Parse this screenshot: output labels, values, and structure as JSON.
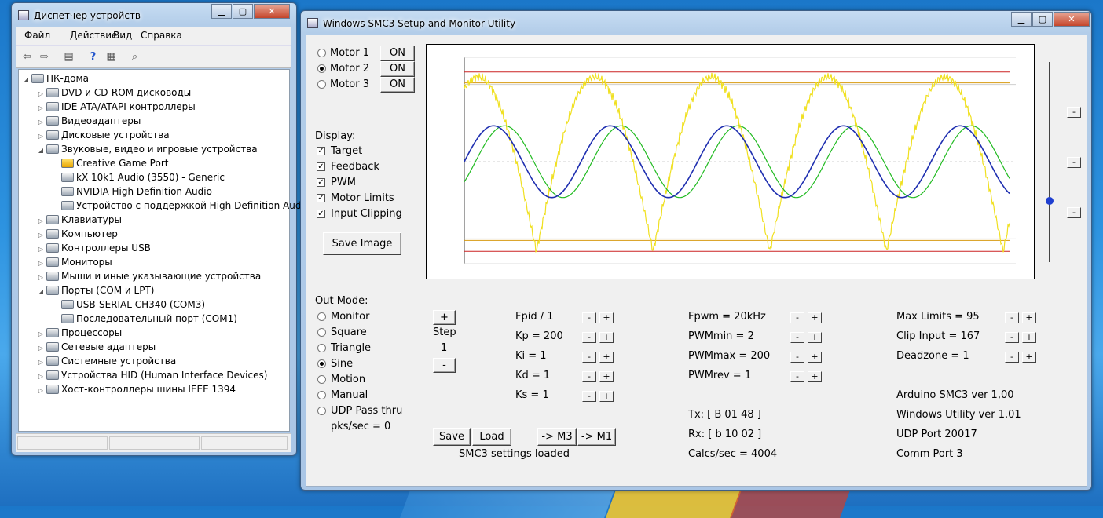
{
  "device_manager": {
    "title": "Диспетчер устройств",
    "menu": [
      "Файл",
      "Действие",
      "Вид",
      "Справка"
    ],
    "tree": [
      {
        "label": "ПК-дома",
        "level": 0,
        "expanded": true,
        "icon": "computer-icon"
      },
      {
        "label": "DVD и CD-ROM дисководы",
        "level": 1,
        "icon": "disc-drive-icon"
      },
      {
        "label": "IDE ATA/ATAPI контроллеры",
        "level": 1,
        "icon": "controller-icon"
      },
      {
        "label": "Видеоадаптеры",
        "level": 1,
        "icon": "display-adapter-icon"
      },
      {
        "label": "Дисковые устройства",
        "level": 1,
        "icon": "disk-icon"
      },
      {
        "label": "Звуковые, видео и игровые устройства",
        "level": 1,
        "expanded": true,
        "icon": "speaker-icon"
      },
      {
        "label": "Creative Game Port",
        "level": 2,
        "icon": "warning-icon",
        "warn": true
      },
      {
        "label": "kX 10k1 Audio (3550) - Generic",
        "level": 2,
        "icon": "speaker-icon"
      },
      {
        "label": "NVIDIA High Definition Audio",
        "level": 2,
        "icon": "speaker-icon"
      },
      {
        "label": "Устройство с поддержкой High Definition Audio",
        "level": 2,
        "icon": "speaker-icon"
      },
      {
        "label": "Клавиатуры",
        "level": 1,
        "icon": "keyboard-icon"
      },
      {
        "label": "Компьютер",
        "level": 1,
        "icon": "computer-icon"
      },
      {
        "label": "Контроллеры USB",
        "level": 1,
        "icon": "usb-icon"
      },
      {
        "label": "Мониторы",
        "level": 1,
        "icon": "monitor-icon"
      },
      {
        "label": "Мыши и иные указывающие устройства",
        "level": 1,
        "icon": "mouse-icon"
      },
      {
        "label": "Порты (COM и LPT)",
        "level": 1,
        "expanded": true,
        "icon": "port-icon"
      },
      {
        "label": "USB-SERIAL CH340 (COM3)",
        "level": 2,
        "icon": "port-icon"
      },
      {
        "label": "Последовательный порт (COM1)",
        "level": 2,
        "icon": "port-icon"
      },
      {
        "label": "Процессоры",
        "level": 1,
        "icon": "cpu-icon"
      },
      {
        "label": "Сетевые адаптеры",
        "level": 1,
        "icon": "network-icon"
      },
      {
        "label": "Системные устройства",
        "level": 1,
        "icon": "system-icon"
      },
      {
        "label": "Устройства HID (Human Interface Devices)",
        "level": 1,
        "icon": "hid-icon"
      },
      {
        "label": "Хост-контроллеры шины IEEE 1394",
        "level": 1,
        "icon": "firewire-icon"
      }
    ]
  },
  "smc3": {
    "title": "Windows SMC3 Setup and Monitor Utility",
    "motors": [
      {
        "label": "Motor 1",
        "button": "ON",
        "selected": false
      },
      {
        "label": "Motor 2",
        "button": "ON",
        "selected": true
      },
      {
        "label": "Motor 3",
        "button": "ON",
        "selected": false
      }
    ],
    "display_label": "Display:",
    "display_options": [
      {
        "label": "Target",
        "checked": true
      },
      {
        "label": "Feedback",
        "checked": true
      },
      {
        "label": "PWM",
        "checked": true
      },
      {
        "label": "Motor Limits",
        "checked": true
      },
      {
        "label": "Input Clipping",
        "checked": true
      }
    ],
    "save_image": "Save Image",
    "out_mode_label": "Out Mode:",
    "out_modes": [
      {
        "label": "Monitor",
        "selected": false
      },
      {
        "label": "Square",
        "selected": false
      },
      {
        "label": "Triangle",
        "selected": false
      },
      {
        "label": "Sine",
        "selected": true
      },
      {
        "label": "Motion",
        "selected": false
      },
      {
        "label": "Manual",
        "selected": false
      },
      {
        "label": "UDP Pass thru",
        "selected": false
      }
    ],
    "pks_sec": "pks/sec = 0",
    "step": {
      "plus": "+",
      "label": "Step",
      "value": "1",
      "minus": "-"
    },
    "pid": [
      "Fpid / 1",
      "Kp = 200",
      "Ki = 1",
      "Kd = 1",
      "Ks = 1"
    ],
    "pwm": [
      "Fpwm = 20kHz",
      "PWMmin = 2",
      "PWMmax = 200",
      "PWMrev = 1"
    ],
    "limits": [
      "Max Limits = 95",
      "Clip Input = 167",
      "Deadzone = 1"
    ],
    "tx": "Tx: [ B 01 48 ]",
    "rx": "Rx: [ b 10 02 ]",
    "calcs": "Calcs/sec = 4004",
    "versions": [
      "Arduino SMC3 ver 1,00",
      "Windows Utility ver 1.01",
      "UDP Port 20017",
      "Comm Port 3"
    ],
    "buttons": {
      "save": "Save",
      "load": "Load",
      "to_m3": "-> M3",
      "to_m1": "-> M1"
    },
    "status": "SMC3 settings loaded",
    "minus": "-",
    "plus": "+"
  },
  "chart_data": {
    "type": "line",
    "colors": {
      "target": "#1f2fb0",
      "feedback": "#22bb22",
      "pwm": "#f0e020",
      "limits": "#cc2222",
      "clip": "#d79a10"
    },
    "series": [
      {
        "key": "target",
        "period_fraction": 0.214,
        "amplitude": 0.36,
        "phase": 0.0
      },
      {
        "key": "feedback",
        "period_fraction": 0.214,
        "amplitude": 0.36,
        "phase": -0.6
      },
      {
        "key": "pwm",
        "period_fraction": 0.214,
        "amplitude": 0.62,
        "phase": 0.6
      }
    ],
    "limit_levels": [
      0.9,
      -0.9
    ],
    "clip_levels": [
      0.79,
      -0.79
    ],
    "grid": true
  }
}
